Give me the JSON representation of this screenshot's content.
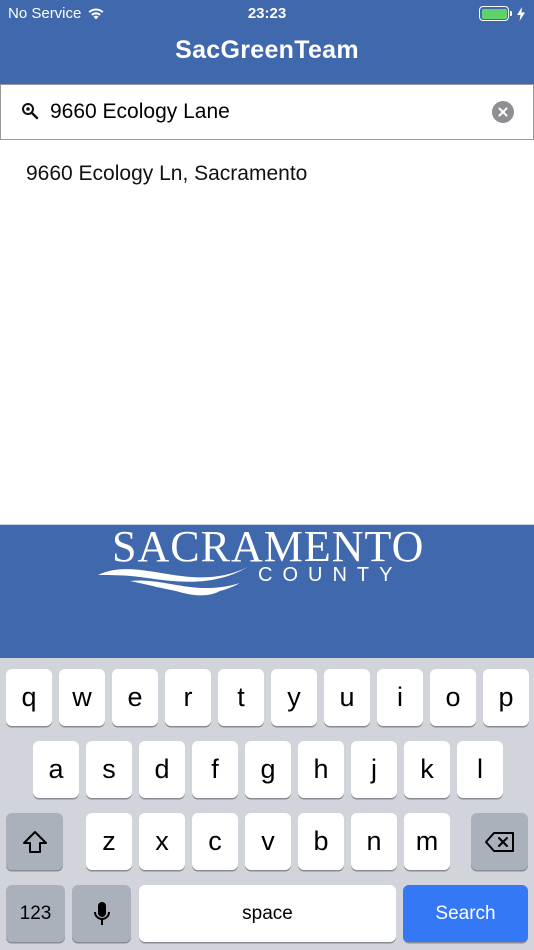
{
  "status_bar": {
    "carrier": "No Service",
    "time": "23:23",
    "battery_color": "#5fd36b"
  },
  "nav": {
    "title": "SacGreenTeam",
    "background_color": "#4068ad"
  },
  "search": {
    "value": "9660 Ecology Lane",
    "icon": "search-icon",
    "clear_icon": "clear-icon"
  },
  "results": [
    {
      "label": "9660 Ecology Ln, Sacramento"
    }
  ],
  "banner": {
    "logo_text_line1": "SACRAMENTO",
    "logo_text_line2": "COUNTY"
  },
  "keyboard": {
    "row1": [
      "q",
      "w",
      "e",
      "r",
      "t",
      "y",
      "u",
      "i",
      "o",
      "p"
    ],
    "row2": [
      "a",
      "s",
      "d",
      "f",
      "g",
      "h",
      "j",
      "k",
      "l"
    ],
    "row3": [
      "z",
      "x",
      "c",
      "v",
      "b",
      "n",
      "m"
    ],
    "shift_icon": "shift-icon",
    "backspace_icon": "backspace-icon",
    "numbers_label": "123",
    "mic_icon": "microphone-icon",
    "space_label": "space",
    "search_label": "Search",
    "search_key_color": "#3478f6"
  }
}
